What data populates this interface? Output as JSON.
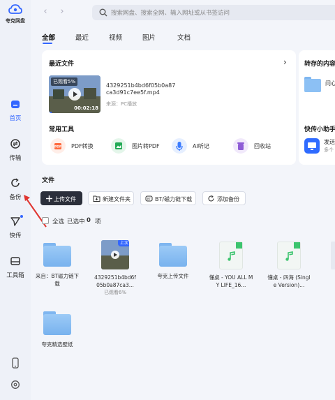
{
  "app": {
    "logo_text": "夸克网盘"
  },
  "sidebar": {
    "items": [
      {
        "label": "首页"
      },
      {
        "label": "传输"
      },
      {
        "label": "备份"
      },
      {
        "label": "快传"
      },
      {
        "label": "工具箱"
      }
    ]
  },
  "search": {
    "placeholder": "搜索网盘、搜索全网、输入网址或从书签访问"
  },
  "tabs": [
    "全部",
    "最近",
    "视频",
    "图片",
    "文档"
  ],
  "recent": {
    "title": "最近文件",
    "chevron": "›",
    "video": {
      "badge": "已观看5%",
      "duration": "00:02:18",
      "name_line1": "4329251b4bd6f05b0a87",
      "name_line2": "ca3d91c7ee5f.mp4",
      "source": "来源：PC播放",
      "watched_fraction": 0.05
    }
  },
  "saved": {
    "title": "转存的内容",
    "item_label": "问心"
  },
  "tools": {
    "title": "常用工具",
    "items": [
      {
        "label": "PDF转换",
        "color": "#ff6a3d"
      },
      {
        "label": "图片转PDF",
        "color": "#22aa55"
      },
      {
        "label": "AI听记",
        "color": "#3a7bff"
      },
      {
        "label": "回收站",
        "color": "#8e5cd6"
      }
    ]
  },
  "helper": {
    "title": "快传小助手",
    "line1": "发送",
    "line2": "多个"
  },
  "files": {
    "title": "文件",
    "buttons": {
      "upload": "上传文件",
      "new_folder": "新建文件夹",
      "bt": "BT/磁力链下载",
      "backup": "添加备份"
    },
    "select_all": "全选",
    "selected_prefix": "已选中",
    "selected_count": "0",
    "selected_suffix": "项",
    "items": [
      {
        "name": "来自：BT磁力链下载",
        "kind": "folder"
      },
      {
        "name": "4329251b4bd6f05b0a87ca3...",
        "kind": "video",
        "sub": "已观看6%",
        "tag": "上次"
      },
      {
        "name": "夸克上传文件",
        "kind": "folder"
      },
      {
        "name": "懂桌 - YOU ALL MY LIFE_16...",
        "kind": "music"
      },
      {
        "name": "懂桌 - 四海 (Single Version)...",
        "kind": "music"
      },
      {
        "name": "夸克精选壁纸",
        "kind": "folder"
      }
    ]
  },
  "colors": {
    "accent": "#3366ff",
    "sidebar_bg": "#eef1f8",
    "page_bg": "#f3f5fa"
  }
}
